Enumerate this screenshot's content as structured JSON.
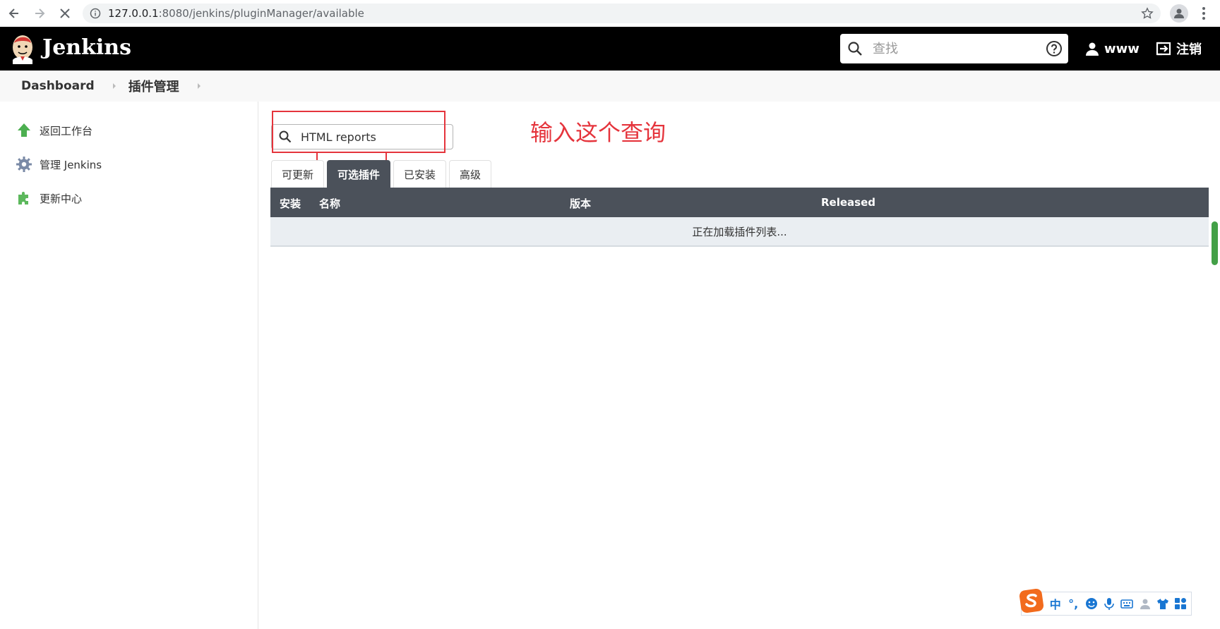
{
  "browser": {
    "url_host": "127.0.0.1",
    "url_path": ":8080/jenkins/pluginManager/available"
  },
  "header": {
    "brand": "Jenkins",
    "search_placeholder": "查找",
    "user": "www",
    "logout": "注销"
  },
  "breadcrumb": {
    "home": "Dashboard",
    "current": "插件管理"
  },
  "sidebar": {
    "items": [
      {
        "label": "返回工作台",
        "icon": "up-arrow-icon"
      },
      {
        "label": "管理 Jenkins",
        "icon": "gear-icon"
      },
      {
        "label": "更新中心",
        "icon": "puzzle-icon"
      }
    ]
  },
  "filter": {
    "value": "HTML reports"
  },
  "annotation": {
    "text": "输入这个查询"
  },
  "tabs": [
    {
      "label": "可更新",
      "active": false
    },
    {
      "label": "可选插件",
      "active": true
    },
    {
      "label": "已安装",
      "active": false
    },
    {
      "label": "高级",
      "active": false
    }
  ],
  "table": {
    "columns": [
      "安装",
      "名称",
      "版本",
      "Released"
    ],
    "loading_text": "正在加载插件列表..."
  },
  "ime": {
    "items": [
      "中",
      "°,",
      "emoji-icon",
      "mic-icon",
      "keyboard-icon",
      "user-icon",
      "shirt-icon",
      "grid-icon"
    ]
  },
  "colors": {
    "header_bg": "#000000",
    "tab_active": "#4b515a",
    "annotation": "#e5343c",
    "scroll_thumb": "#43a047"
  }
}
